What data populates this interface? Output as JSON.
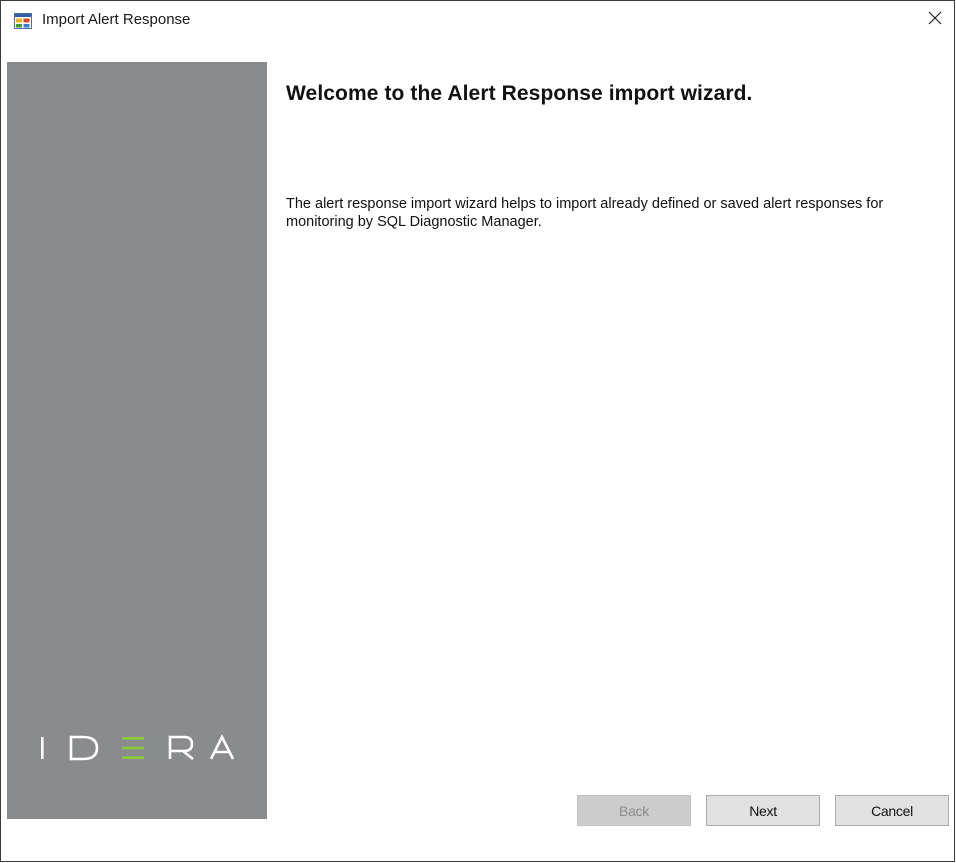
{
  "window": {
    "title": "Import Alert Response",
    "close_glyph": "✕",
    "icon": "app-window-icon"
  },
  "sidebar": {
    "logo_text": "IDERA",
    "logo_accent_color": "#8dc63f",
    "background_color": "#8a8b8f"
  },
  "content": {
    "heading": "Welcome to the Alert Response import wizard.",
    "description": "The alert response import wizard helps to import already defined or saved alert responses for monitoring by SQL Diagnostic Manager."
  },
  "buttons": {
    "back": {
      "label": "Back",
      "enabled": false
    },
    "next": {
      "label": "Next",
      "enabled": true
    },
    "cancel": {
      "label": "Cancel",
      "enabled": true
    }
  }
}
